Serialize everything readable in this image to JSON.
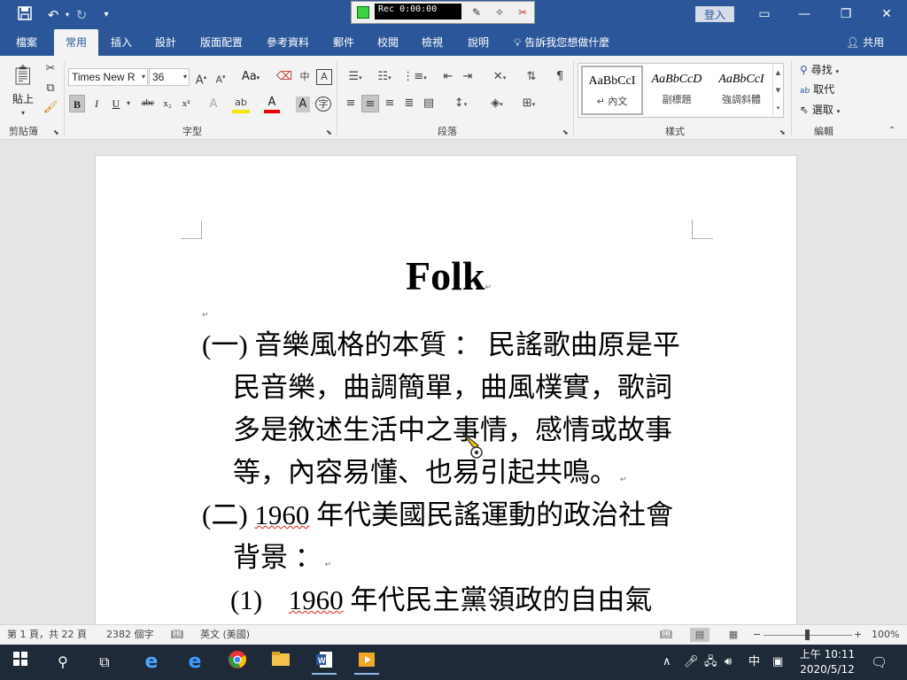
{
  "titlebar": {
    "recorder": {
      "time": "Rec 0:00:00"
    },
    "login_label": "登入"
  },
  "tabs": [
    {
      "label": "檔案"
    },
    {
      "label": "常用"
    },
    {
      "label": "插入"
    },
    {
      "label": "設計"
    },
    {
      "label": "版面配置"
    },
    {
      "label": "參考資料"
    },
    {
      "label": "郵件"
    },
    {
      "label": "校閱"
    },
    {
      "label": "檢視"
    },
    {
      "label": "說明"
    }
  ],
  "tellme": "告訴我您想做什麼",
  "share": "共用",
  "ribbon": {
    "clipboard": {
      "paste_label": "貼上",
      "group_label": "剪貼簿"
    },
    "font": {
      "name": "Times New R",
      "size": "36",
      "case_label": "Aa",
      "group_label": "字型",
      "bold": "B",
      "italic": "I",
      "underline": "U",
      "strike": "abc"
    },
    "paragraph": {
      "group_label": "段落"
    },
    "styles": {
      "group_label": "樣式",
      "items": [
        {
          "sample": "AaBbCcI",
          "name": "↵ 內文"
        },
        {
          "sample": "AaBbCcD",
          "name": "副標題"
        },
        {
          "sample": "AaBbCcI",
          "name": "強調斜體"
        }
      ]
    },
    "editing": {
      "find": "尋找",
      "replace": "取代",
      "select": "選取",
      "group_label": "編輯"
    }
  },
  "document": {
    "title": "Folk",
    "para1_num": "(一)",
    "para1_line1": "音樂風格的本質 ： 民謠歌曲原是平",
    "para1_line2": "民音樂，曲調簡單，曲風樸實，歌詞",
    "para1_line3": "多是敘述生活中之事情，感情或故事",
    "para1_line4": "等，內容易懂、也易引起共鳴。",
    "para2_num": "(二)",
    "para2_year": "1960",
    "para2_line1_rest": "年代美國民謠運動的政治社會",
    "para2_line2": "背景 ：",
    "para3_num": "(1)",
    "para3_year": "1960",
    "para3_rest": "年代民主黨領政的自由氣"
  },
  "status": {
    "page": "第 1 頁，共 22 頁",
    "words": "2382 個字",
    "language": "英文 (美國)",
    "zoom": "100%",
    "zoom_percent": 100
  },
  "taskbar": {
    "ime": "中",
    "time": "上午 10:11",
    "date": "2020/5/12"
  }
}
